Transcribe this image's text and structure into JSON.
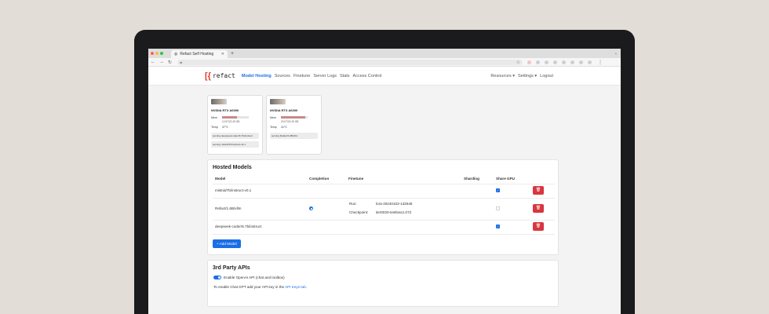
{
  "browser": {
    "tab_title": "Refact Self Hosting",
    "new_tab": "+",
    "address": "",
    "traffic_colors": [
      "#ff5f57",
      "#febc2e",
      "#28c840"
    ]
  },
  "nav": {
    "logo_icon": "[{",
    "logo_text": "refact",
    "links": [
      "Model Hosting",
      "Sources",
      "Finetune",
      "Server Logs",
      "Stats",
      "Access Control"
    ],
    "right": [
      "Resources ▾",
      "Settings ▾",
      "Logout"
    ],
    "active_color": "#1a6ee6"
  },
  "gpus": [
    {
      "name": "NVIDIA RTX A6000",
      "mem_label": "Mem",
      "mem_fraction": 0.57,
      "mem_text": "12.57/22.49 GB",
      "temp_label": "Temp",
      "temp": "37°C",
      "serving": [
        "serving deepseek-coder/6.7b/instruct",
        "serving mistral/7b/instruct-v0.1"
      ]
    },
    {
      "name": "NVIDIA RTX A6000",
      "mem_label": "Mem",
      "mem_fraction": 0.92,
      "mem_text": "20.07/22.49 GB",
      "temp_label": "Temp",
      "temp": "41°C",
      "serving": [
        "serving Refact/1.6B/vllm"
      ]
    }
  ],
  "hosted": {
    "title": "Hosted Models",
    "headers": [
      "Model",
      "Completion",
      "Finetune",
      "Sharding",
      "Share GPU"
    ],
    "rows": [
      {
        "model": "mistral/7b/instruct-v0.1",
        "completion": false,
        "run_label": "",
        "run": "",
        "checkpoint_label": "",
        "checkpoint": "",
        "share_gpu": true
      },
      {
        "model": "Refact/1.6B/vllm",
        "completion": true,
        "run_label": "Run:",
        "run": "lora-20240102-132646",
        "checkpoint_label": "Checkpoint:",
        "checkpoint": "iter0020-testloss1.072",
        "share_gpu": false
      },
      {
        "model": "deepseek-coder/6.7b/instruct",
        "completion": false,
        "run_label": "",
        "run": "",
        "checkpoint_label": "",
        "checkpoint": "",
        "share_gpu": true
      }
    ],
    "add_label": "+ Add Model",
    "delete_icon": "trash-icon"
  },
  "third_party": {
    "title": "3rd Party APIs",
    "toggle_label": "Enable OpenAI API (chat and toolbox)",
    "hint_prefix": "To enable Chat GPT add your API key in the ",
    "hint_link": "API Keys tab",
    "hint_suffix": "."
  },
  "colors": {
    "accent": "#1a6ee6",
    "danger": "#d9363e",
    "logo": "#e33b2a",
    "mem_fill": "#c98a8a"
  }
}
